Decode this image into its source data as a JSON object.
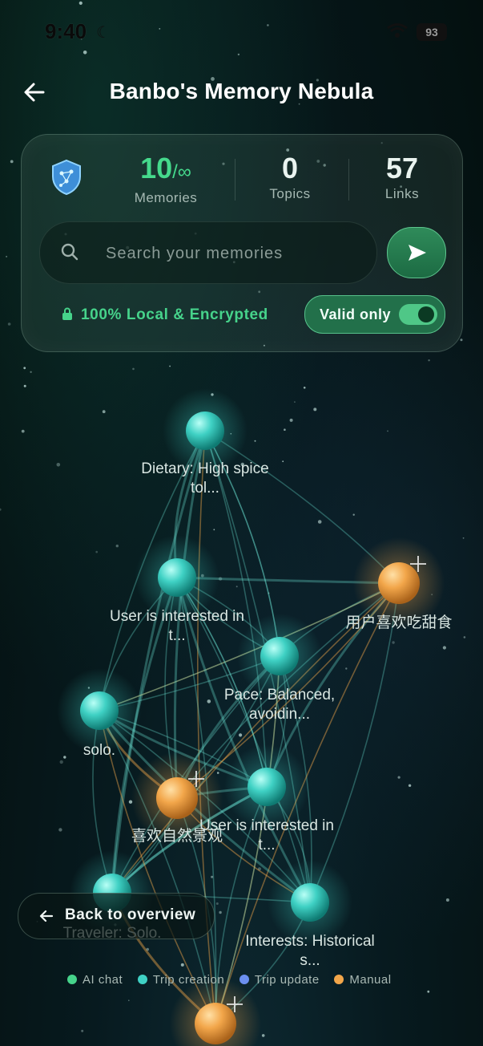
{
  "status_bar": {
    "time": "9:40",
    "battery": "93"
  },
  "header": {
    "title": "Banbo's Memory Nebula"
  },
  "stats": {
    "memories": {
      "value": "10",
      "suffix": "/∞",
      "label": "Memories"
    },
    "topics": {
      "value": "0",
      "label": "Topics"
    },
    "links": {
      "value": "57",
      "label": "Links"
    }
  },
  "search": {
    "placeholder": "Search your memories"
  },
  "privacy": {
    "label": "100% Local & Encrypted"
  },
  "filter": {
    "label": "Valid only",
    "enabled": true
  },
  "nodes": [
    {
      "label": "Dietary: High spice",
      "label2": "tol...",
      "type": "Trip creation",
      "color": "#3fd1c4"
    },
    {
      "label": "User is interested in",
      "label2": "t...",
      "type": "Trip creation",
      "color": "#3fd1c4"
    },
    {
      "label": "用户喜欢吃甜食",
      "label2": "",
      "type": "Manual",
      "color": "#f2a64a"
    },
    {
      "label": "Pace: Balanced,",
      "label2": "avoidin...",
      "type": "Trip creation",
      "color": "#3fd1c4"
    },
    {
      "label": "solo.",
      "label2": "",
      "type": "Trip creation",
      "color": "#3fd1c4"
    },
    {
      "label": "喜欢自然景观",
      "label2": "",
      "type": "Manual",
      "color": "#f2a64a"
    },
    {
      "label": "User is interested in",
      "label2": "t...",
      "type": "Trip creation",
      "color": "#3fd1c4"
    },
    {
      "label": "Traveler: Solo.",
      "label2": "",
      "type": "Trip creation",
      "color": "#3fd1c4"
    },
    {
      "label": "Interests: Historical",
      "label2": "s...",
      "type": "Trip creation",
      "color": "#3fd1c4"
    },
    {
      "label": "",
      "label2": "",
      "type": "Manual",
      "color": "#f2a64a"
    }
  ],
  "back_overview": {
    "label": "Back to overview"
  },
  "legend": [
    {
      "label": "AI chat",
      "color": "#46d38b"
    },
    {
      "label": "Trip creation",
      "color": "#3fd1c4"
    },
    {
      "label": "Trip update",
      "color": "#6b8ff0"
    },
    {
      "label": "Manual",
      "color": "#f2a64a"
    }
  ]
}
